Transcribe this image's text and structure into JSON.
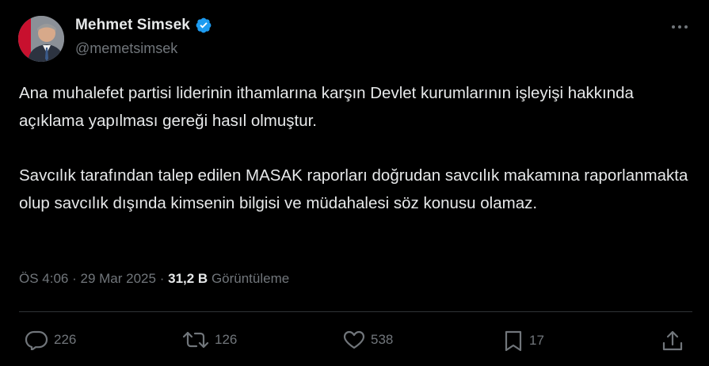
{
  "author": {
    "display_name": "Mehmet Simsek",
    "handle": "@memetsimsek",
    "verified": true
  },
  "tweet": {
    "paragraphs": [
      "Ana muhalefet partisi liderinin ithamlarına karşın Devlet kurumlarının işleyişi hakkında açıklama yapılması gereği hasıl olmuştur.",
      "Savcılık tarafından talep edilen MASAK raporları doğrudan savcılık makamına raporlanmakta olup savcılık dışında kimsenin bilgisi ve müdahalesi söz konusu olamaz."
    ],
    "time": "ÖS 4:06",
    "separator": "·",
    "date": "29 Mar 2025",
    "views_count": "31,2 B",
    "views_label": "Görüntüleme"
  },
  "actions": {
    "replies": "226",
    "reposts": "126",
    "likes": "538",
    "bookmarks": "17"
  },
  "icons": {
    "more": "more-icon",
    "verified": "verified-badge-icon",
    "reply": "reply-icon",
    "repost": "repost-icon",
    "like": "heart-icon",
    "bookmark": "bookmark-icon",
    "share": "share-icon"
  },
  "colors": {
    "background": "#000000",
    "text": "#e7e9ea",
    "secondary_text": "#71767b",
    "verified": "#1d9bf0",
    "divider": "#2f3336"
  }
}
